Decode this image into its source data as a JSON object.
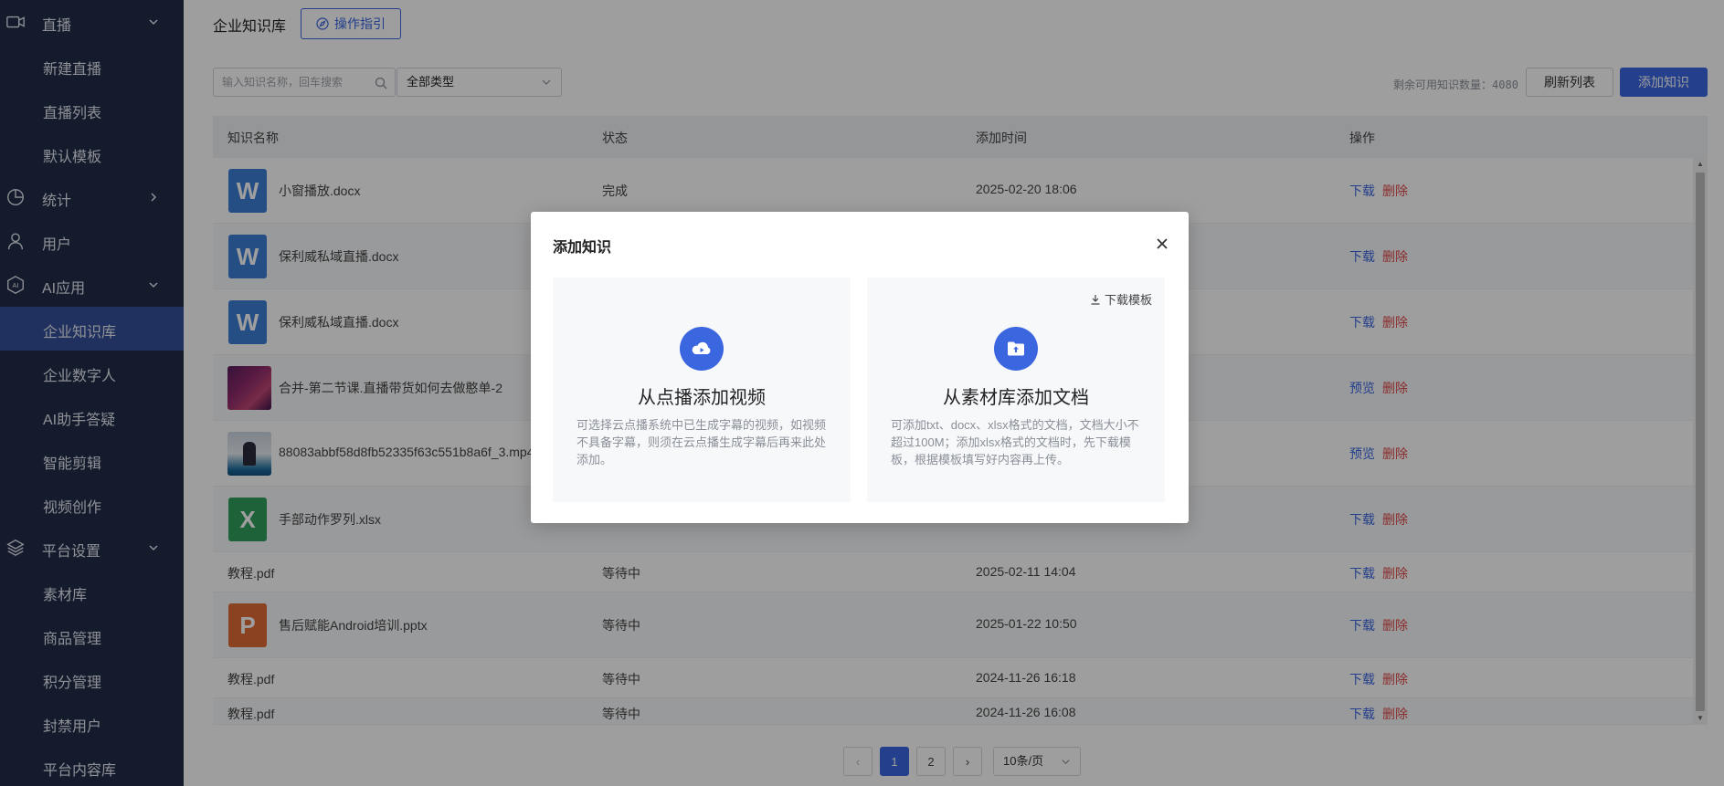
{
  "sidebar": {
    "items": [
      {
        "label": "直播",
        "icon": "video-camera-icon",
        "chevron": "down"
      },
      {
        "label": "新建直播"
      },
      {
        "label": "直播列表"
      },
      {
        "label": "默认模板"
      },
      {
        "label": "统计",
        "icon": "pie-chart-icon",
        "chevron": "right"
      },
      {
        "label": "用户",
        "icon": "user-icon"
      },
      {
        "label": "AI应用",
        "icon": "ai-icon",
        "chevron": "down"
      },
      {
        "label": "企业知识库",
        "active": true
      },
      {
        "label": "企业数字人"
      },
      {
        "label": "AI助手答疑"
      },
      {
        "label": "智能剪辑"
      },
      {
        "label": "视频创作"
      },
      {
        "label": "平台设置",
        "icon": "layers-icon",
        "chevron": "down"
      },
      {
        "label": "素材库"
      },
      {
        "label": "商品管理"
      },
      {
        "label": "积分管理"
      },
      {
        "label": "封禁用户"
      },
      {
        "label": "平台内容库"
      }
    ],
    "ai_icon_text": "AI"
  },
  "header": {
    "title": "企业知识库",
    "guide_label": "操作指引"
  },
  "toolbar": {
    "search_placeholder": "输入知识名称，回车搜索",
    "type_select_value": "全部类型",
    "remain_label": "剩余可用知识数量：",
    "remain_count": "4080",
    "refresh_label": "刷新列表",
    "add_label": "添加知识"
  },
  "table": {
    "headers": [
      "知识名称",
      "状态",
      "添加时间",
      "操作"
    ],
    "rows": [
      {
        "name": "小窗播放.docx",
        "thumb": "word",
        "thumb_text": "W",
        "status": "完成",
        "time": "2025-02-20 18:06",
        "action": "下载",
        "delete": "删除"
      },
      {
        "name": "保利威私域直播.docx",
        "thumb": "word",
        "thumb_text": "W",
        "status": "",
        "time": "",
        "action": "下载",
        "delete": "删除"
      },
      {
        "name": "保利威私域直播.docx",
        "thumb": "word",
        "thumb_text": "W",
        "status": "",
        "time": "",
        "action": "下载",
        "delete": "删除"
      },
      {
        "name": "合并-第二节课.直播带货如何去做憨单-2",
        "thumb": "img1",
        "thumb_text": "",
        "status": "",
        "time": "",
        "action": "预览",
        "delete": "删除"
      },
      {
        "name": "88083abbf58d8fb52335f63c551b8a6f_3.mp4",
        "thumb": "img2",
        "thumb_text": "",
        "status": "",
        "time": "",
        "action": "预览",
        "delete": "删除"
      },
      {
        "name": "手部动作罗列.xlsx",
        "thumb": "excel",
        "thumb_text": "X",
        "status": "",
        "time": "",
        "action": "下载",
        "delete": "删除"
      },
      {
        "name": "教程.pdf",
        "thumb": "",
        "thumb_text": "",
        "status": "等待中",
        "time": "2025-02-11 14:04",
        "action": "下载",
        "delete": "删除"
      },
      {
        "name": "售后赋能Android培训.pptx",
        "thumb": "ppt",
        "thumb_text": "P",
        "status": "等待中",
        "time": "2025-01-22 10:50",
        "action": "下载",
        "delete": "删除"
      },
      {
        "name": "教程.pdf",
        "thumb": "",
        "thumb_text": "",
        "status": "等待中",
        "time": "2024-11-26 16:18",
        "action": "下载",
        "delete": "删除"
      },
      {
        "name": "教程.pdf",
        "thumb": "",
        "thumb_text": "",
        "status": "等待中",
        "time": "2024-11-26 16:08",
        "action": "下载",
        "delete": "删除"
      }
    ]
  },
  "pagination": {
    "prev": "‹",
    "pages": [
      "1",
      "2"
    ],
    "current": "1",
    "next": "›",
    "page_size": "10条/页"
  },
  "modal": {
    "title": "添加知识",
    "close_label": "×",
    "cards": [
      {
        "title": "从点播添加视频",
        "icon": "cloud-play-icon",
        "description": "可选择云点播系统中已生成字幕的视频，如视频不具备字幕，则须在云点播生成字幕后再来此处添加。"
      },
      {
        "title": "从素材库添加文档",
        "icon": "folder-upload-icon",
        "description": "可添加txt、docx、xlsx格式的文档，文档大小不超过100M；添加xlsx格式的文档时，先下载模板，根据模板填写好内容再上传。",
        "download_template": "下载模板"
      }
    ]
  },
  "colors": {
    "sidebar_bg": "#1f2d4a",
    "accent": "#3a66e0",
    "danger": "#e04a4a",
    "overlay": "rgba(0,0,0,0.38)"
  }
}
